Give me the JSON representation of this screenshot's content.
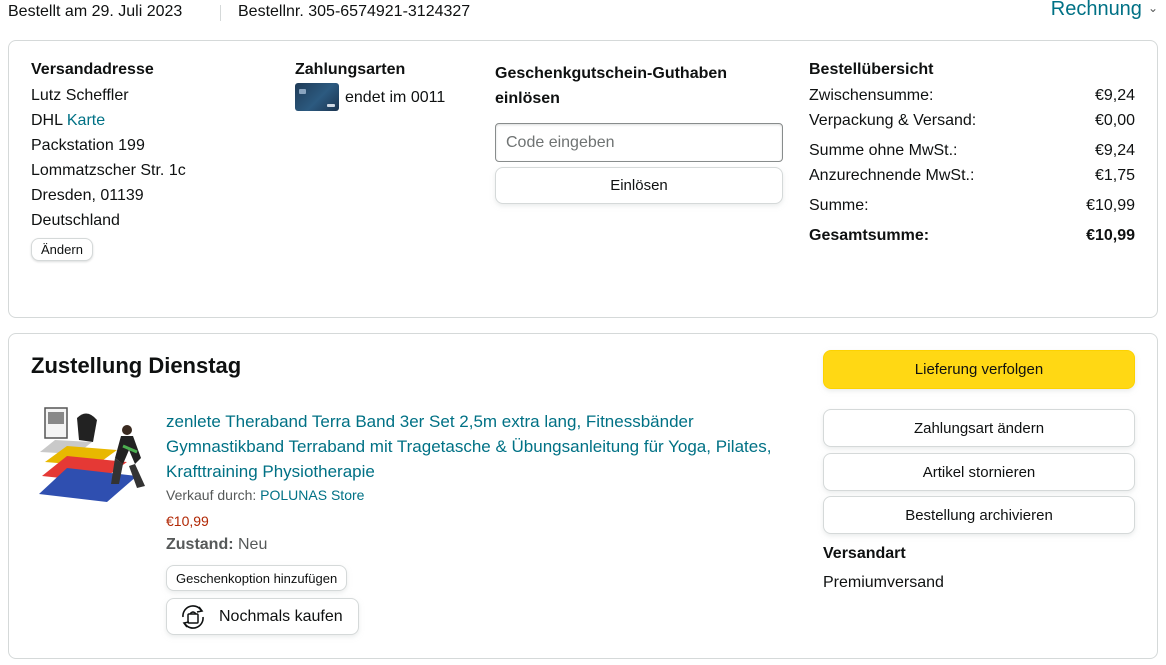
{
  "header": {
    "ordered_on": "Bestellt am 29. Juli 2023",
    "order_number": "Bestellnr. 305-6574921-3124327",
    "invoice_label": "Rechnung"
  },
  "address": {
    "heading": "Versandadresse",
    "name": "Lutz Scheffler",
    "carrier": "DHL",
    "carrier_link": "Karte",
    "line1": "Packstation 199",
    "line2": "Lommatzscher Str. 1c",
    "line3": "Dresden, 01139",
    "country": "Deutschland",
    "change_label": "Ändern"
  },
  "payment": {
    "heading": "Zahlungsarten",
    "card_text": "endet im 0011"
  },
  "giftcard": {
    "heading": "Geschenkgutschein-Guthaben einlösen",
    "placeholder": "Code eingeben",
    "redeem_label": "Einlösen"
  },
  "summary": {
    "heading": "Bestellübersicht",
    "rows": [
      {
        "label": "Zwischensumme:",
        "value": "€9,24"
      },
      {
        "label": "Verpackung & Versand:",
        "value": "€0,00"
      },
      {
        "label": "Summe ohne MwSt.:",
        "value": "€9,24"
      },
      {
        "label": "Anzurechnende MwSt.:",
        "value": "€1,75"
      },
      {
        "label": "Summe:",
        "value": "€10,99"
      },
      {
        "label": "Gesamtsumme:",
        "value": "€10,99"
      }
    ]
  },
  "delivery": {
    "title": "Zustellung Dienstag",
    "product": {
      "title": "zenlete Theraband Terra Band 3er Set 2,5m extra lang, Fitnessbänder Gymnastikband Terraband mit Tragetasche & Übungsanleitung für Yoga, Pilates, Krafttraining Physiotherapie",
      "seller_label": "Verkauf durch:",
      "seller_name": "POLUNAS Store",
      "price": "€10,99",
      "condition_label": "Zustand:",
      "condition_value": "Neu",
      "gift_option_label": "Geschenkoption hinzufügen",
      "buy_again_label": "Nochmals kaufen"
    },
    "actions": {
      "track": "Lieferung verfolgen",
      "change_payment": "Zahlungsart ändern",
      "cancel": "Artikel stornieren",
      "archive": "Bestellung archivieren"
    },
    "shipping_heading": "Versandart",
    "shipping_value": "Premiumversand"
  },
  "colors": {
    "link": "#007185",
    "track_button": "#ffd814",
    "price": "#b12704",
    "border": "#d5d9d9"
  }
}
